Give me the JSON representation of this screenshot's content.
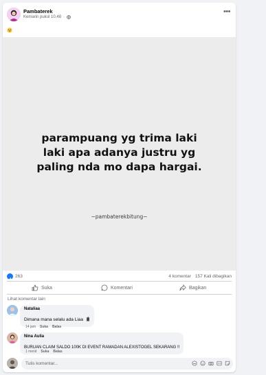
{
  "post": {
    "page_name": "Pambaterek",
    "timestamp": "Kemarin pukul 10.48",
    "caption_emoji": "smiling-emoji",
    "image": {
      "lines": [
        "parampuang yg trima laki",
        "laki apa adanya justru yg",
        "paling nda mo dapa hargai."
      ],
      "watermark": "~pambaterekbitung~"
    }
  },
  "stats": {
    "reactions": "263",
    "comments": "4 komentar",
    "shares": "157 Kali dibagikan"
  },
  "actions": {
    "like": "Suka",
    "comment": "Komentari",
    "share": "Bagikan"
  },
  "more_comments_label": "Lihat komentar lain",
  "comments": [
    {
      "author": "Nataliaa",
      "text": "Dimana mana selalu ada Liaa",
      "time": "14 jam",
      "like": "Suka",
      "reply": "Balas"
    },
    {
      "author": "Nina Aulia",
      "text": "BURUAN CLAIM SALDO 100K DI EVENT RAMADAN ALEXISTOGEL SEKARANG !!",
      "time": "1 menit",
      "like": "Suka",
      "reply": "Balas"
    }
  ],
  "composer": {
    "placeholder": "Tulis komentar..."
  },
  "colors": {
    "accent": "#1877f2",
    "muted": "#65676b",
    "bubble": "#f0f2f5"
  }
}
